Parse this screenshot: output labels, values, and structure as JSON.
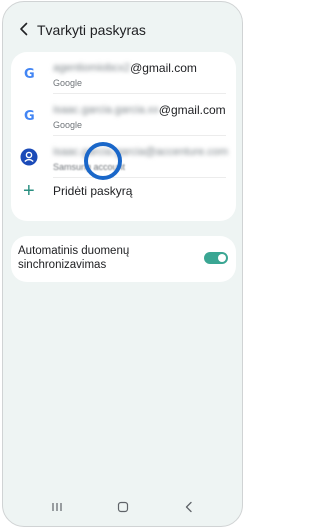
{
  "header": {
    "title": "Tvarkyti paskyras",
    "back_icon": "chevron-left-icon"
  },
  "accounts": [
    {
      "icon": "google-icon",
      "email_hidden": "agentiomiobcx2",
      "email_domain": "@gmail.com",
      "type_label": "Google"
    },
    {
      "icon": "google-icon",
      "email_hidden": "isaac.garcia.garcia.xx",
      "email_domain": "@gmail.com",
      "type_label": "Google"
    },
    {
      "icon": "samsung-account-icon",
      "email_hidden": "isaac.garcia.garcia@accenture.com",
      "email_domain": "",
      "type_label": "Samsung account"
    }
  ],
  "add_account": {
    "icon": "plus-icon",
    "label": "Pridėti paskyrą"
  },
  "sync": {
    "label": "Automatinis duomenų sinchronizavimas",
    "enabled": true
  },
  "colors": {
    "accent": "#3aa693",
    "highlight_circle": "#1a67c9",
    "background": "#eef4f3",
    "samsung_icon": "#1b4bb8",
    "google_blue": "#4285f4",
    "google_red": "#ea4335",
    "google_yellow": "#fbbc05",
    "google_green": "#34a853"
  },
  "navbar": [
    "recent-apps-icon",
    "home-icon",
    "back-icon"
  ]
}
